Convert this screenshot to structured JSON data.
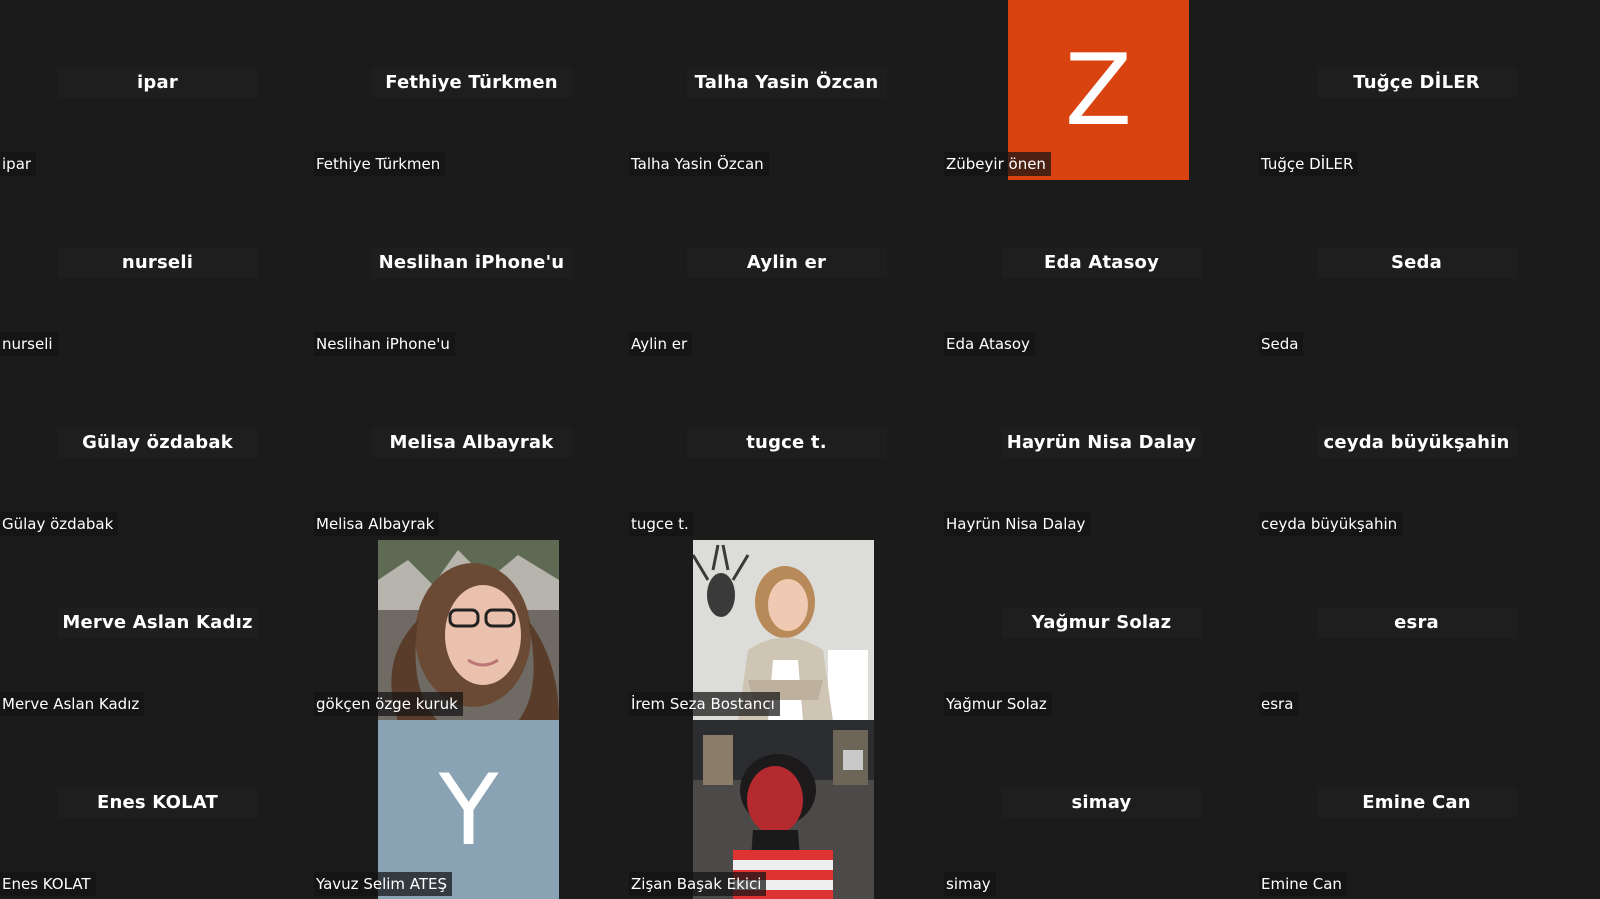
{
  "gallery": {
    "rows": [
      [
        {
          "name": "ipar",
          "center": "ipar"
        },
        {
          "name": "Fethiye Türkmen",
          "center": "Fethiye Türkmen"
        },
        {
          "name": "Talha Yasin Özcan",
          "center": "Talha Yasin Özcan"
        },
        {
          "name": "Zübeyir önen",
          "avatar_letter": "Z",
          "avatar_color": "#d8430f"
        },
        {
          "name": "Tuğçe DİLER",
          "center": "Tuğçe DİLER"
        }
      ],
      [
        {
          "name": "nurseli",
          "center": "nurseli"
        },
        {
          "name": "Neslihan iPhone'u",
          "center": "Neslihan iPhone'u"
        },
        {
          "name": "Aylin er",
          "center": "Aylin er"
        },
        {
          "name": "Eda Atasoy",
          "center": "Eda Atasoy"
        },
        {
          "name": "Seda",
          "center": "Seda"
        }
      ],
      [
        {
          "name": "Gülay özdabak",
          "center": "Gülay özdabak"
        },
        {
          "name": "Melisa Albayrak",
          "center": "Melisa Albayrak"
        },
        {
          "name": "tugce t.",
          "center": "tugce t."
        },
        {
          "name": "Hayrün Nisa Dalay",
          "center": "Hayrün Nisa Dalay"
        },
        {
          "name": "ceyda büyükşahin",
          "center": "ceyda büyükşahin"
        }
      ],
      [
        {
          "name": "Merve Aslan Kadız",
          "center": "Merve Aslan Kadız"
        },
        {
          "name": "gökçen özge kuruk",
          "video": "webcam-photo"
        },
        {
          "name": "İrem Seza Bostancı",
          "video": "webcam-photo"
        },
        {
          "name": "Yağmur Solaz",
          "center": "Yağmur Solaz"
        },
        {
          "name": "esra",
          "center": "esra"
        }
      ],
      [
        {
          "name": "Enes KOLAT",
          "center": "Enes KOLAT"
        },
        {
          "name": "Yavuz Selim ATEŞ",
          "avatar_letter": "Y",
          "avatar_color": "#89a2b4"
        },
        {
          "name": "Zişan Başak Ekici",
          "video": "webcam-photo"
        },
        {
          "name": "simay",
          "center": "simay"
        },
        {
          "name": "Emine Can",
          "center": "Emine Can"
        }
      ]
    ]
  },
  "colors": {
    "background": "#1b1b1b",
    "name_plate": "#1e1e1e",
    "text": "#ffffff"
  }
}
